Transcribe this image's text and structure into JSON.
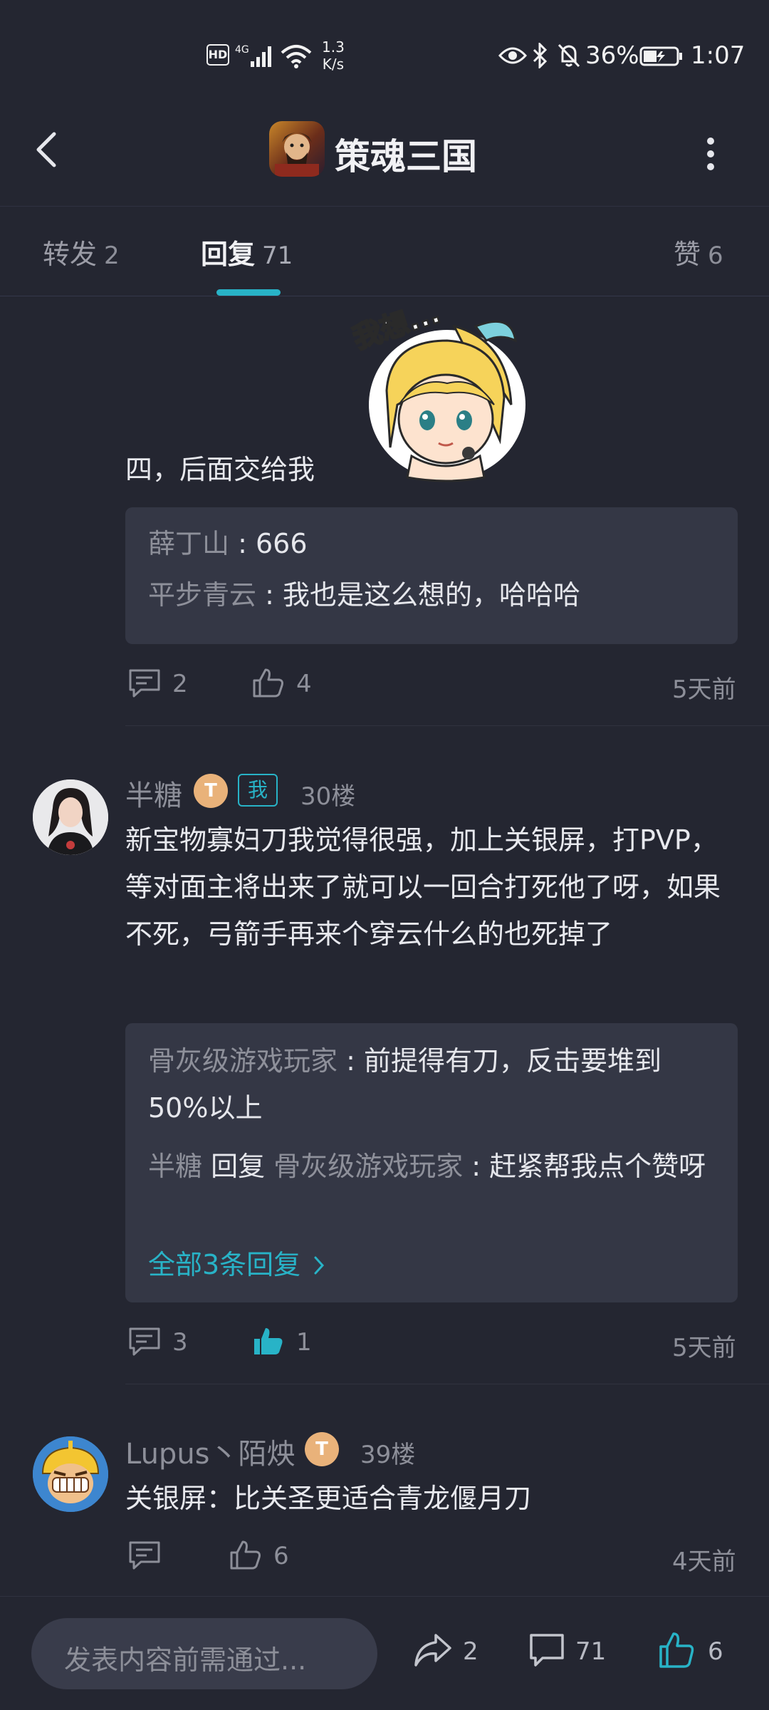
{
  "status_bar": {
    "network": "1.3",
    "network_unit": "K/s",
    "battery": "36%",
    "time": "1:07"
  },
  "header": {
    "title": "策魂三国"
  },
  "tabs": [
    {
      "label": "转发",
      "count": "2"
    },
    {
      "label": "回复",
      "count": "71"
    },
    {
      "label": "赞",
      "count": "6"
    }
  ],
  "post1": {
    "text": "四，后面交给我",
    "sticker_text": "我想...",
    "replies": [
      {
        "user": "薛丁山",
        "sep": " : ",
        "text": "666"
      },
      {
        "user": "平步青云",
        "sep": " : ",
        "text": "我也是这么想的，哈哈哈"
      }
    ],
    "comment_count": "2",
    "like_count": "4",
    "time": "5天前"
  },
  "post2": {
    "user": "半糖",
    "level": "T",
    "me": "我",
    "floor": "30楼",
    "text": "新宝物寡妇刀我觉得很强，加上关银屏，打PVP，等对面主将出来了就可以一回合打死他了呀，如果不死，弓箭手再来个穿云什么的也死掉了",
    "reply1_user": "骨灰级游戏玩家",
    "reply1_sep": " : ",
    "reply1_text": "前提得有刀，反击要堆到50%以上",
    "reply2_user": "半糖",
    "reply2_word": " 回复 ",
    "reply2_target": "骨灰级游戏玩家",
    "reply2_sep": " : ",
    "reply2_text": "赶紧帮我点个赞呀",
    "all_replies": "全部3条回复",
    "comment_count": "3",
    "like_count": "1",
    "time": "5天前"
  },
  "post3": {
    "user": "Lupus丶陌炴",
    "level": "T",
    "floor": "39楼",
    "text": "关银屏：比关圣更适合青龙偃月刀",
    "like_count": "6",
    "time": "4天前"
  },
  "bottom_bar": {
    "placeholder": "发表内容前需通过...",
    "share_count": "2",
    "comment_count": "71",
    "like_count": "6"
  },
  "colors": {
    "background": "#242631",
    "accent": "#28b3c7",
    "quote_bg": "#343745"
  }
}
